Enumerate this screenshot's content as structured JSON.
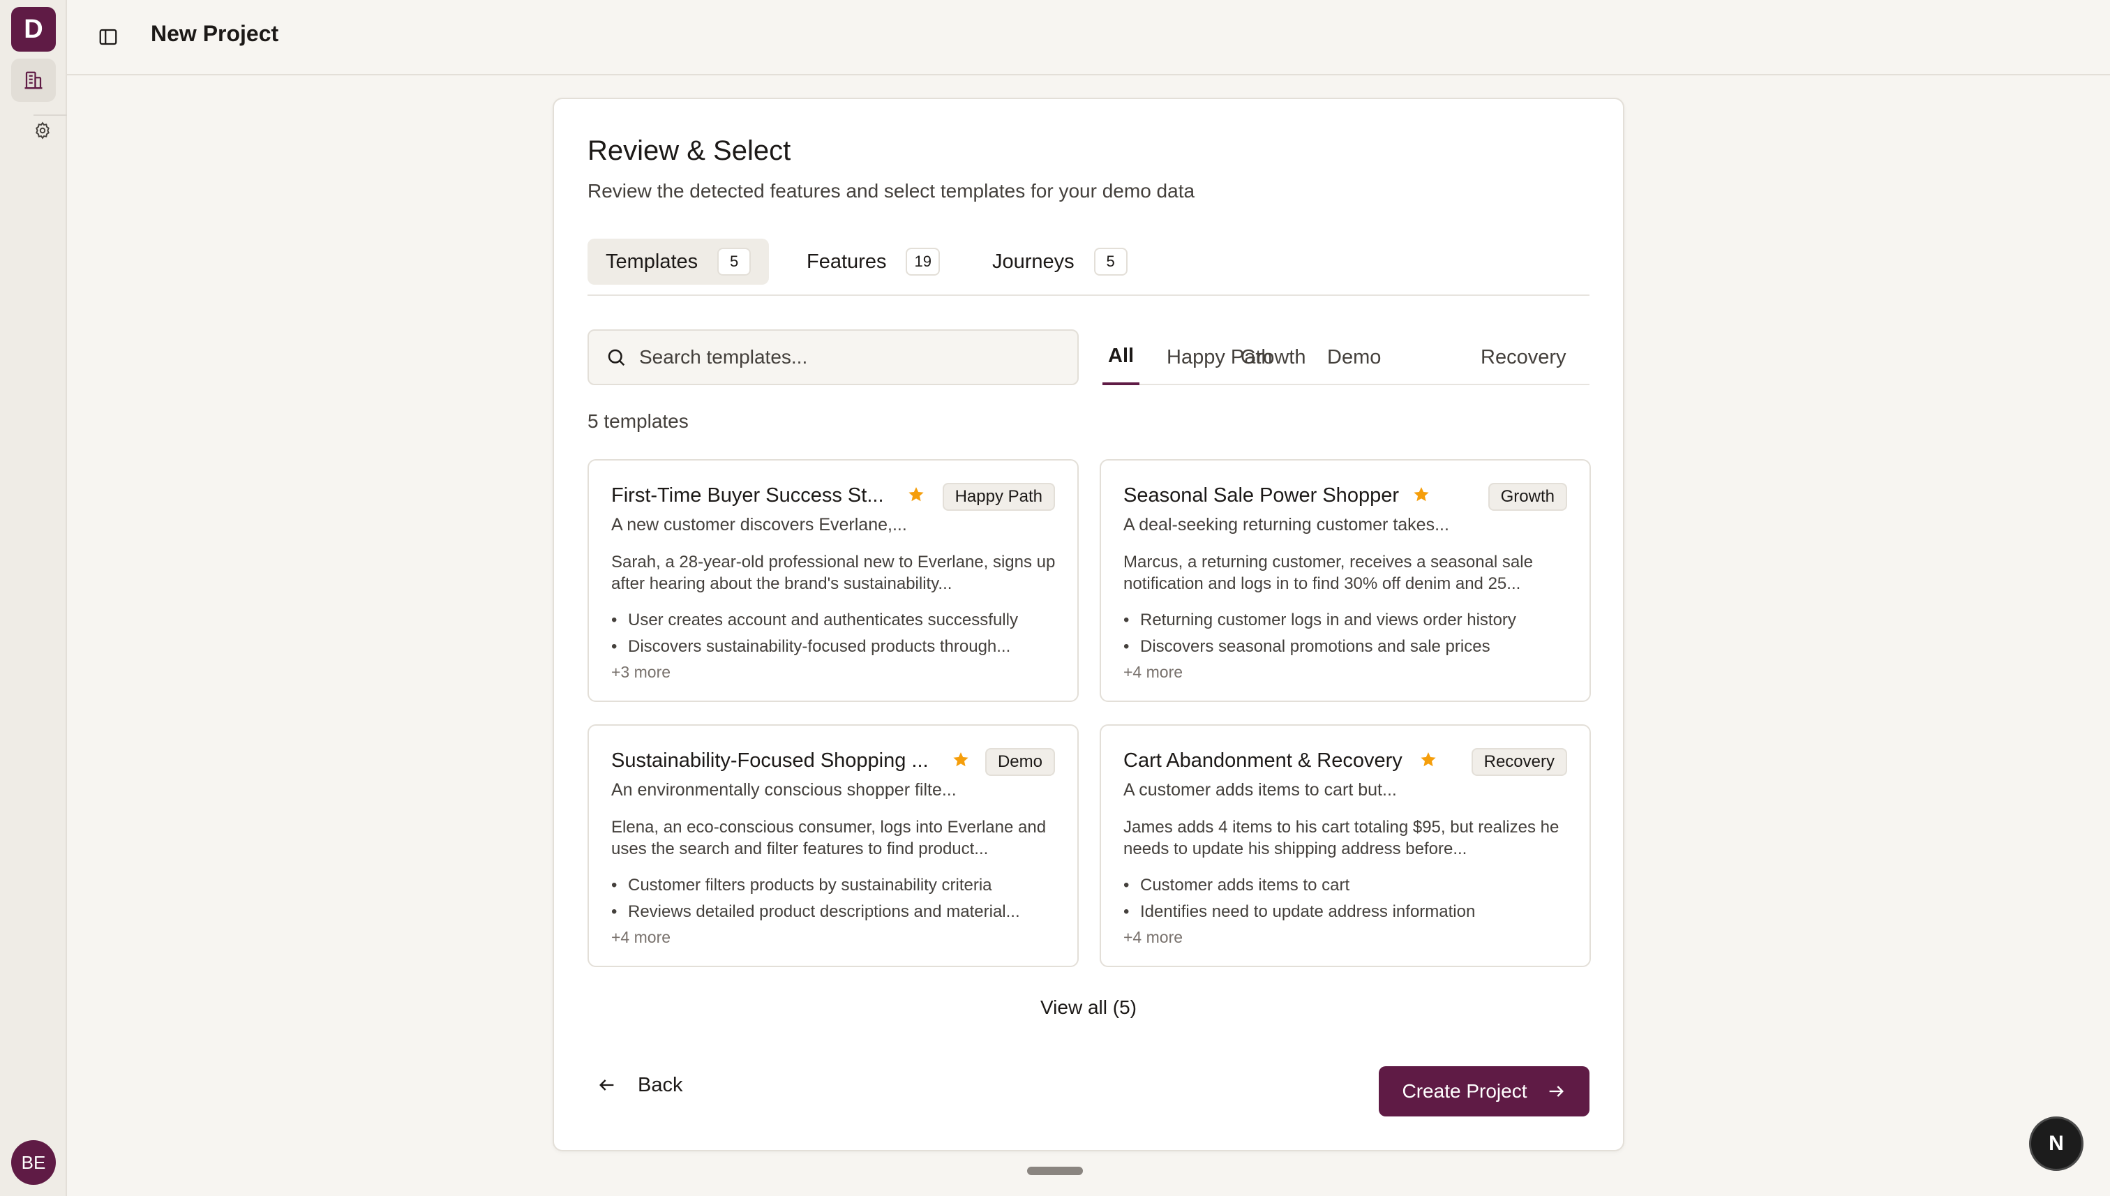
{
  "sidebar": {
    "logo_letter": "D",
    "avatar_initials": "BE",
    "icons": [
      "building-icon",
      "gear-icon"
    ]
  },
  "header": {
    "title": "New Project"
  },
  "card": {
    "title": "Review & Select",
    "subtitle": "Review the detected features and select templates for your demo data",
    "tabs": [
      {
        "label": "Templates",
        "count": "5"
      },
      {
        "label": "Features",
        "count": "19"
      },
      {
        "label": "Journeys",
        "count": "5"
      }
    ],
    "search_placeholder": "Search templates...",
    "filters": [
      "All",
      "Happy Path",
      "Growth",
      "Demo",
      "Recovery"
    ],
    "result_count": "5 templates",
    "templates": [
      {
        "title": "First-Time Buyer Success St...",
        "badge": "Happy Path",
        "summary": "A new customer discovers Everlane,...",
        "description": "Sarah, a 28-year-old professional new to Everlane, signs up after hearing about the brand's sustainability...",
        "bullets": [
          "User creates account and authenticates successfully",
          "Discovers sustainability-focused products through..."
        ],
        "more": "+3 more"
      },
      {
        "title": "Seasonal Sale Power Shopper",
        "badge": "Growth",
        "summary": "A deal-seeking returning customer takes...",
        "description": "Marcus, a returning customer, receives a seasonal sale notification and logs in to find 30% off denim and 25...",
        "bullets": [
          "Returning customer logs in and views order history",
          "Discovers seasonal promotions and sale prices"
        ],
        "more": "+4 more"
      },
      {
        "title": "Sustainability-Focused Shopping ...",
        "badge": "Demo",
        "summary": "An environmentally conscious shopper filte...",
        "description": "Elena, an eco-conscious consumer, logs into Everlane and uses the search and filter features to find product...",
        "bullets": [
          "Customer filters products by sustainability criteria",
          "Reviews detailed product descriptions and material..."
        ],
        "more": "+4 more"
      },
      {
        "title": "Cart Abandonment & Recovery",
        "badge": "Recovery",
        "summary": "A customer adds items to cart but...",
        "description": "James adds 4 items to his cart totaling $95, but realizes he needs to update his shipping address before...",
        "bullets": [
          "Customer adds items to cart",
          "Identifies need to update address information"
        ],
        "more": "+4 more"
      }
    ],
    "view_all": "View all (5)",
    "back_label": "Back",
    "create_label": "Create Project"
  },
  "colors": {
    "accent": "#5f1b45",
    "star": "#f59e0b"
  },
  "next_badge": "N"
}
